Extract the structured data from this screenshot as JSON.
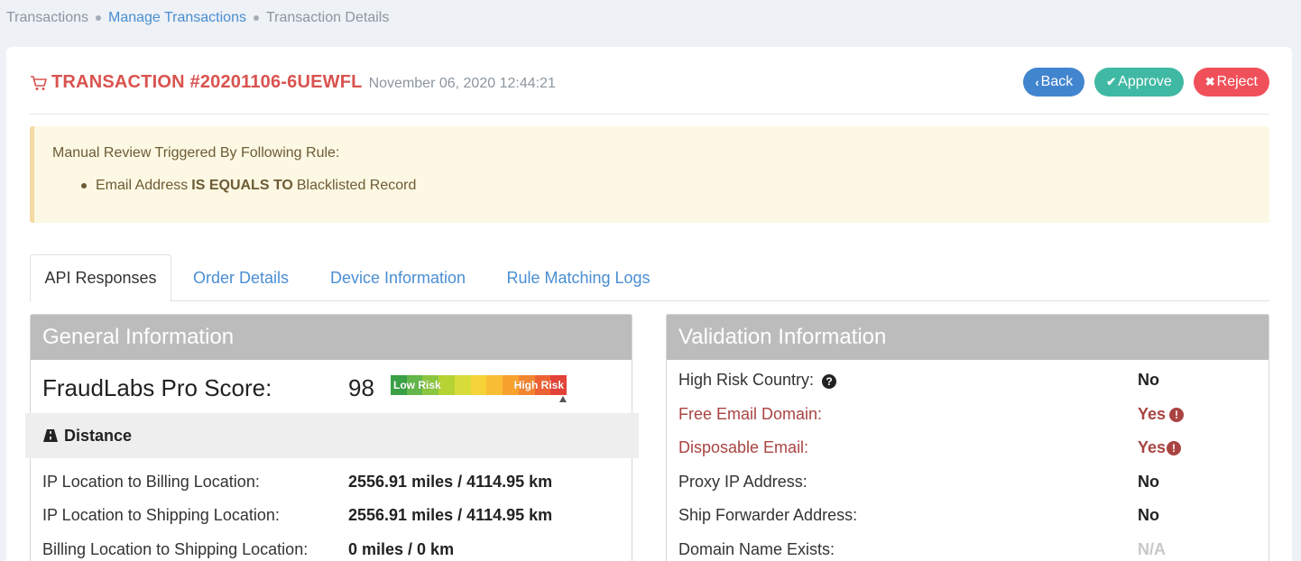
{
  "breadcrumb": {
    "items": [
      "Transactions",
      "Manage Transactions",
      "Transaction Details"
    ]
  },
  "transaction": {
    "title": "TRANSACTION #20201106-6UEWFL",
    "date": "November 06, 2020 12:44:21"
  },
  "actions": {
    "back": "Back",
    "approve": "Approve",
    "reject": "Reject"
  },
  "alert": {
    "heading": "Manual Review Triggered By Following Rule:",
    "rule_field": "Email Address",
    "rule_operator": "IS EQUALS TO",
    "rule_value": "Blacklisted Record"
  },
  "tabs": [
    "API Responses",
    "Order Details",
    "Device Information",
    "Rule Matching Logs"
  ],
  "general": {
    "title": "General Information",
    "score_label": "FraudLabs Pro Score:",
    "score_value": "98",
    "score_fraction": 0.98,
    "risk_low_label": "Low Risk",
    "risk_high_label": "High Risk",
    "risk_colors": [
      "#3aa046",
      "#62b64a",
      "#8cc641",
      "#b6d334",
      "#d7dc3a",
      "#f7d33a",
      "#f9bd35",
      "#f7a22f",
      "#f28530",
      "#ec6134",
      "#e34238"
    ],
    "distance_title": "Distance",
    "rows": [
      {
        "label": "IP Location to Billing Location:",
        "value": "2556.91 miles / 4114.95 km"
      },
      {
        "label": "IP Location to Shipping Location:",
        "value": "2556.91 miles / 4114.95 km"
      },
      {
        "label": "Billing Location to Shipping Location:",
        "value": "0 miles / 0 km"
      }
    ]
  },
  "validation": {
    "title": "Validation Information",
    "rows": [
      {
        "label": "High Risk Country:",
        "value": "No"
      },
      {
        "label": "Free Email Domain:",
        "value": "Yes"
      },
      {
        "label": "Disposable Email:",
        "value": "Yes"
      },
      {
        "label": "Proxy IP Address:",
        "value": "No"
      },
      {
        "label": "Ship Forwarder Address:",
        "value": "No"
      },
      {
        "label": "Domain Name Exists:",
        "value": "N/A"
      }
    ]
  },
  "colors": {
    "accent_red": "#d9534f",
    "link_blue": "#4a8ed2",
    "warning_text": "#a94442"
  }
}
